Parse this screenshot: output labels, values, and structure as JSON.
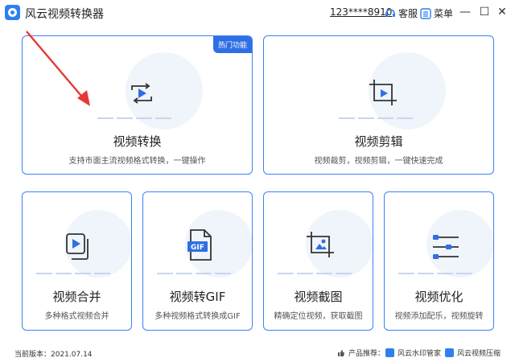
{
  "app": {
    "title": "风云视频转换器"
  },
  "header": {
    "account": "123****8910",
    "support_label": "客服",
    "menu_label": "菜单"
  },
  "cards": {
    "convert": {
      "title": "视频转换",
      "desc": "支持市面主流视频格式转换，一键操作",
      "badge": "热门功能"
    },
    "edit": {
      "title": "视频剪辑",
      "desc": "视频裁剪，视频剪辑，一键快速完成"
    },
    "merge": {
      "title": "视频合并",
      "desc": "多种格式视频合并"
    },
    "gif": {
      "title": "视频转GIF",
      "desc": "多种视频格式转换成GIF",
      "icon_text": "GIF"
    },
    "screenshot": {
      "title": "视频截图",
      "desc": "精确定位视频，获取截图"
    },
    "optimize": {
      "title": "视频优化",
      "desc": "视频添加配乐，视频旋转"
    }
  },
  "status": {
    "version": "当前版本：2021.07.14",
    "promo_label": "产品推荐：",
    "promo_1": "风云水印管家",
    "promo_2": "风云视频压缩"
  },
  "colors": {
    "accent": "#2f6fe4",
    "border": "#3b82f6",
    "arrow": "#e53935"
  }
}
